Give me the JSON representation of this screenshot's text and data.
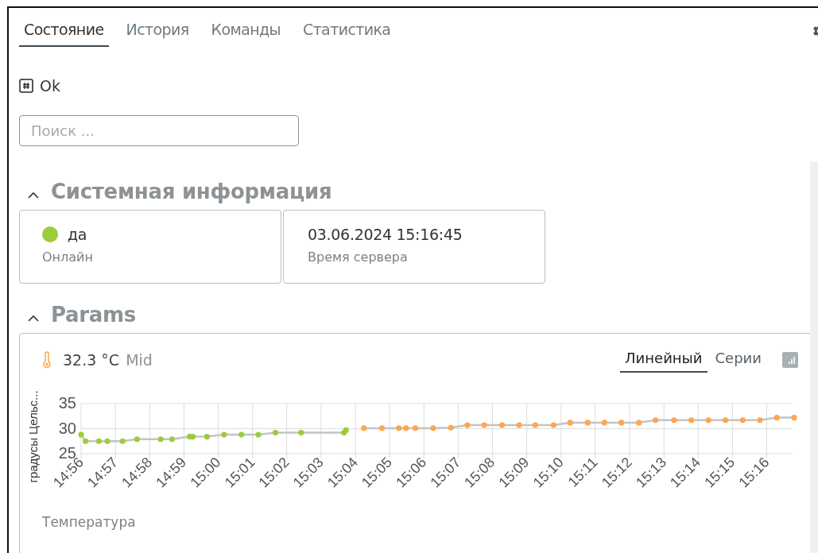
{
  "tabs": [
    {
      "label": "Состояние",
      "selected": true
    },
    {
      "label": "История",
      "selected": false
    },
    {
      "label": "Команды",
      "selected": false
    },
    {
      "label": "Статистика",
      "selected": false
    }
  ],
  "status": {
    "label": "Ok"
  },
  "search": {
    "placeholder": "Поиск ..."
  },
  "sections": [
    {
      "title": "Системная информация",
      "expanded": true,
      "kind": "tiles",
      "tiles": [
        {
          "value": "да",
          "label": "Онлайн",
          "dot": true,
          "color": "#9ccc3c"
        },
        {
          "value": "03.06.2024 15:16:45",
          "label": "Время сервера",
          "dot": false
        }
      ]
    },
    {
      "title": "Params",
      "expanded": true,
      "kind": "chart",
      "reading": "32.3 °C",
      "quality": "Mid",
      "views": [
        {
          "label": "Линейный",
          "selected": true
        },
        {
          "label": "Серии",
          "selected": false
        }
      ],
      "chart_data": {
        "type": "line",
        "grid": true,
        "ylabel": "градусы Цельс...",
        "xlim": [
          14.9333,
          15.28
        ],
        "ylim": [
          25,
          35
        ],
        "yticks": [
          25,
          30,
          35
        ],
        "xticks": [
          {
            "value": 14.9333,
            "label": "14:56"
          },
          {
            "value": 14.95,
            "label": "14:57"
          },
          {
            "value": 14.9667,
            "label": "14:58"
          },
          {
            "value": 14.9833,
            "label": "14:59"
          },
          {
            "value": 15,
            "label": "15:00"
          },
          {
            "value": 15.0167,
            "label": "15:01"
          },
          {
            "value": 15.0333,
            "label": "15:02"
          },
          {
            "value": 15.05,
            "label": "15:03"
          },
          {
            "value": 15.0667,
            "label": "15:04"
          },
          {
            "value": 15.0833,
            "label": "15:05"
          },
          {
            "value": 15.1,
            "label": "15:06"
          },
          {
            "value": 15.1167,
            "label": "15:07"
          },
          {
            "value": 15.1333,
            "label": "15:08"
          },
          {
            "value": 15.15,
            "label": "15:09"
          },
          {
            "value": 15.1667,
            "label": "15:10"
          },
          {
            "value": 15.1833,
            "label": "15:11"
          },
          {
            "value": 15.2,
            "label": "15:12"
          },
          {
            "value": 15.2167,
            "label": "15:13"
          },
          {
            "value": 15.2333,
            "label": "15:14"
          },
          {
            "value": 15.25,
            "label": "15:15"
          },
          {
            "value": 15.2667,
            "label": "15:16"
          }
        ],
        "x": [
          14.9333,
          14.9355,
          14.942,
          14.9461,
          14.9535,
          14.9605,
          14.972,
          14.9775,
          14.9861,
          14.9876,
          14.9945,
          15.0028,
          15.0113,
          15.0195,
          15.0278,
          15.0403,
          15.0611,
          15.0621,
          15.0708,
          15.0796,
          15.0878,
          15.0913,
          15.0958,
          15.1045,
          15.1131,
          15.1211,
          15.1293,
          15.138,
          15.1463,
          15.1541,
          15.163,
          15.1711,
          15.1796,
          15.1878,
          15.196,
          15.2045,
          15.2126,
          15.2216,
          15.23,
          15.2383,
          15.2466,
          15.255,
          15.2633,
          15.2716,
          15.28
        ],
        "series": [
          {
            "name": "Температура",
            "color": "#9ccc3c",
            "marker": true,
            "values": [
              28.8,
              27.5,
              27.5,
              27.5,
              27.5,
              27.9,
              27.9,
              27.9,
              28.4,
              28.4,
              28.4,
              28.8,
              28.8,
              28.8,
              29.2,
              29.2,
              29.2,
              29.7,
              null,
              null,
              null,
              null,
              null,
              null,
              null,
              null,
              null,
              null,
              null,
              null,
              null,
              null,
              null,
              null,
              null,
              null,
              null,
              null,
              null,
              null,
              null,
              null,
              null,
              null,
              null
            ]
          },
          {
            "color": "#ffa552",
            "marker": true,
            "values": [
              null,
              null,
              null,
              null,
              null,
              null,
              null,
              null,
              null,
              null,
              null,
              null,
              null,
              null,
              null,
              null,
              null,
              null,
              30.1,
              30.1,
              30.1,
              30.1,
              30.1,
              30.1,
              30.2,
              30.7,
              30.7,
              30.7,
              30.7,
              30.7,
              30.7,
              31.2,
              31.2,
              31.2,
              31.2,
              31.2,
              31.7,
              31.7,
              31.7,
              31.7,
              31.7,
              31.7,
              31.7,
              32.2,
              32.2
            ]
          }
        ]
      }
    }
  ]
}
